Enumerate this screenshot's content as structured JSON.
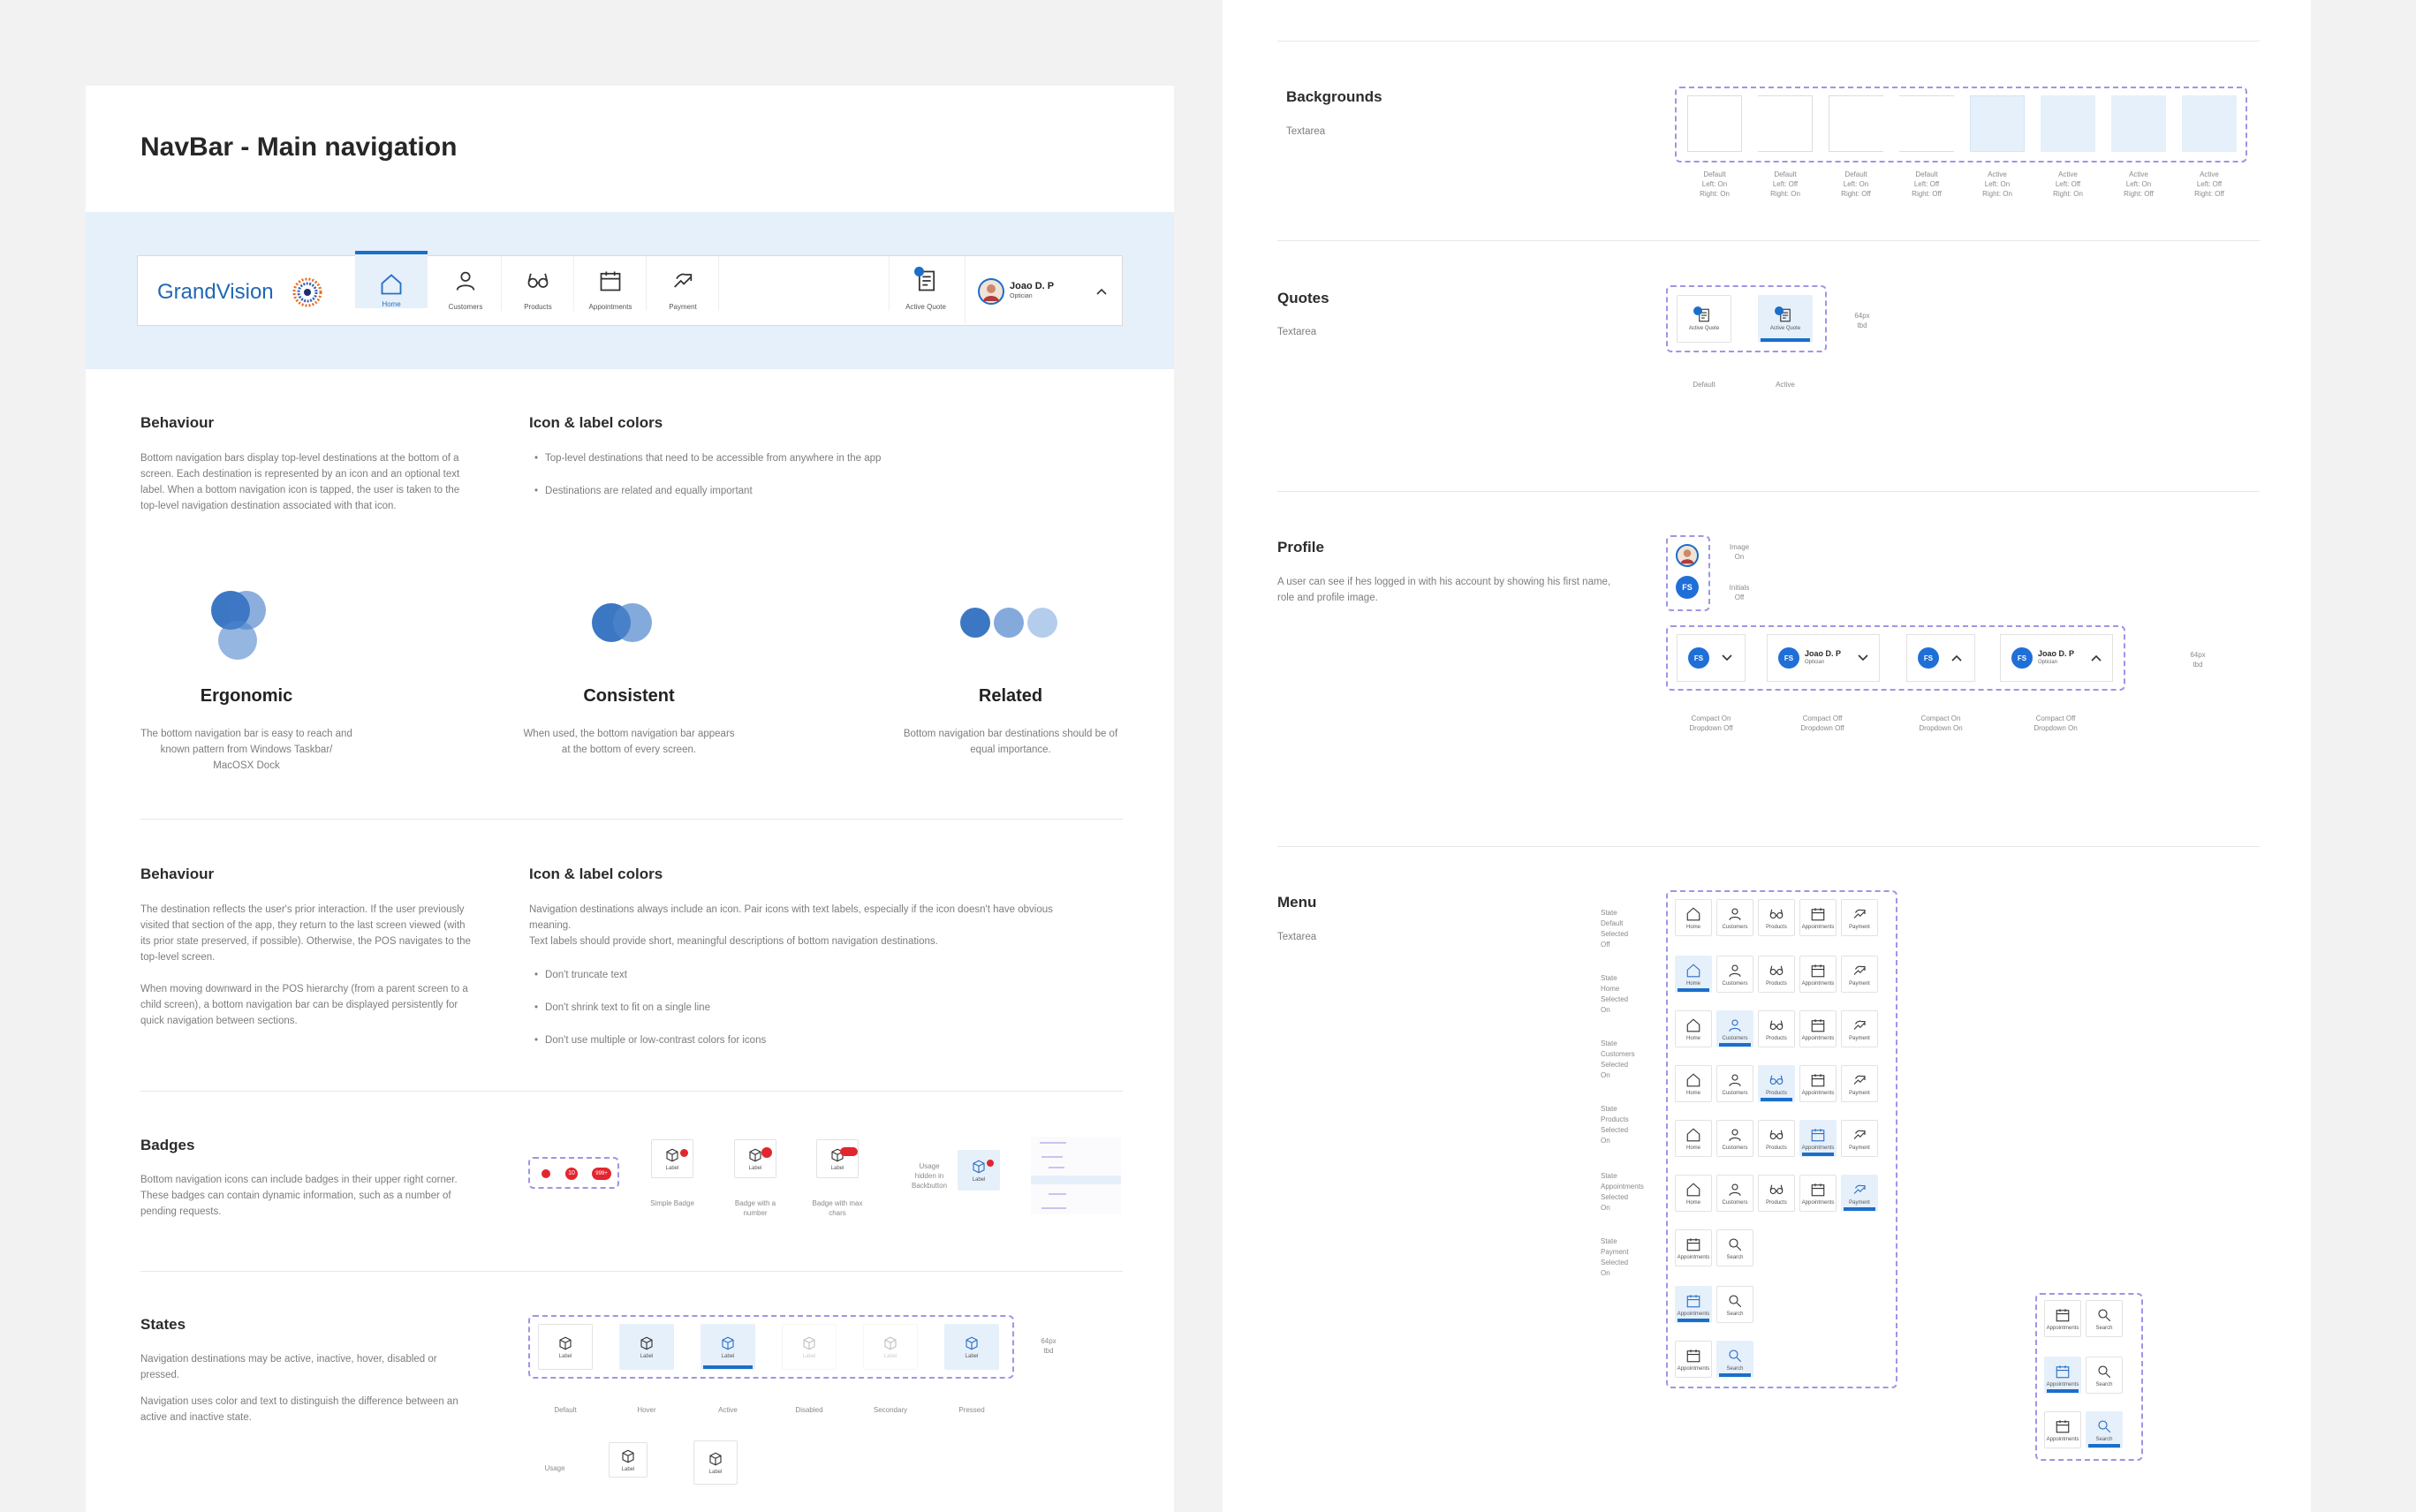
{
  "main": {
    "title": "NavBar - Main navigation",
    "navbar": {
      "brand": "GrandVision",
      "items": [
        {
          "label": "Home",
          "icon": "home-icon",
          "active": true
        },
        {
          "label": "Customers",
          "icon": "user-icon",
          "active": false
        },
        {
          "label": "Products",
          "icon": "glasses-icon",
          "active": false
        },
        {
          "label": "Appointments",
          "icon": "calendar-icon",
          "active": false
        },
        {
          "label": "Payment",
          "icon": "payment-icon",
          "active": false
        }
      ],
      "active_quote": "Active Quote",
      "user_name": "Joao D. P",
      "user_role": "Optician"
    },
    "behaviour1": {
      "title": "Behaviour",
      "body": "Bottom navigation bars display top-level destinations at the bottom of a screen. Each destination is represented by an icon and an optional text label. When a bottom navigation icon is tapped, the user is taken to the top-level navigation destination associated with that icon."
    },
    "colors1": {
      "title": "Icon & label colors",
      "bullets": [
        "Top-level destinations that need to be accessible from anywhere in the app",
        "Destinations are related and equally important"
      ]
    },
    "principles": [
      {
        "title": "Ergonomic",
        "body": "The bottom navigation bar is easy to reach and known pattern from Windows Taskbar/ MacOSX Dock"
      },
      {
        "title": "Consistent",
        "body": "When used, the bottom navigation bar appears at the bottom of every screen."
      },
      {
        "title": "Related",
        "body": "Bottom navigation bar destinations should be of equal importance."
      }
    ],
    "behaviour2": {
      "title": "Behaviour",
      "p1": "The destination reflects the user's prior interaction. If the user previously visited that section of the app, they return to the last screen viewed (with its prior state preserved, if possible). Otherwise, the POS navigates to the top-level screen.",
      "p2": "When moving downward in the POS hierarchy (from a parent screen to a child screen), a bottom navigation bar can be displayed persistently for quick navigation between sections."
    },
    "colors2": {
      "title": "Icon & label colors",
      "p1": "Navigation destinations always include an icon. Pair icons with text labels, especially if the icon doesn't have obvious meaning.",
      "p2": "Text labels should provide short, meaningful descriptions of bottom navigation destinations.",
      "bullets": [
        "Don't truncate text",
        "Don't shrink text to fit on a single line",
        "Don't use multiple or low-contrast colors for icons"
      ]
    },
    "badges": {
      "title": "Badges",
      "body": "Bottom navigation icons can include badges in their upper right corner. These badges can contain dynamic information, such as a number of pending requests.",
      "chips": [
        "10",
        "999+"
      ],
      "examples": [
        "Simple Badge",
        "Badge with a number",
        "Badge with max chars"
      ],
      "usage_note": "Usage hidden in Backbutton",
      "label": "Label"
    },
    "states": {
      "title": "States",
      "p1": "Navigation destinations may be active, inactive, hover, disabled or pressed.",
      "p2": "Navigation uses color and text to distinguish the difference between an active and inactive state.",
      "label": "Label",
      "names": [
        "Default",
        "Hover",
        "Active",
        "Disabled",
        "Secondary",
        "Pressed"
      ],
      "size": "64px tbd",
      "usage": "Usage"
    }
  },
  "side": {
    "backgrounds": {
      "title": "Backgrounds",
      "sub": "Textarea",
      "captions": [
        [
          "Default",
          "Left: On",
          "Right: On"
        ],
        [
          "Default",
          "Left: Off",
          "Right: On"
        ],
        [
          "Default",
          "Left: On",
          "Right: Off"
        ],
        [
          "Default",
          "Left: Off",
          "Right: Off"
        ],
        [
          "Active",
          "Left: On",
          "Right: On"
        ],
        [
          "Active",
          "Left: Off",
          "Right: On"
        ],
        [
          "Active",
          "Left: On",
          "Right: Off"
        ],
        [
          "Active",
          "Left: Off",
          "Right: Off"
        ]
      ]
    },
    "quotes": {
      "title": "Quotes",
      "sub": "Textarea",
      "label": "Active Quote",
      "states": [
        "Default",
        "Active"
      ],
      "size": "64px tbd"
    },
    "profile": {
      "title": "Profile",
      "body": "A user can see if hes logged in with his account by showing his first name, role and profile image.",
      "image_on": "Image On",
      "initials_off": "Initials Off",
      "initials": "FS",
      "name": "Joao D. P",
      "role": "Optician",
      "captions": [
        [
          "Compact On",
          "Dropdown Off"
        ],
        [
          "Compact Off",
          "Dropdown Off"
        ],
        [
          "Compact On",
          "Dropdown On"
        ],
        [
          "Compact Off",
          "Dropdown On"
        ]
      ],
      "size": "64px tbd"
    },
    "menu": {
      "title": "Menu",
      "sub": "Textarea",
      "state_labels": [
        "State Default Selected Off",
        "State Home Selected On",
        "State Customers Selected On",
        "State Products Selected On",
        "State Appointments Selected On",
        "State Payment Selected On"
      ],
      "labels": [
        "Home",
        "Customers",
        "Products",
        "Appointments",
        "Payment"
      ],
      "short_labels": [
        "Appointments",
        "Search"
      ]
    }
  },
  "colors": {
    "accent": "#1a6fc9",
    "highlight": "#e6f0fb",
    "dash": "#9f95e6",
    "badge": "#e3262e"
  }
}
